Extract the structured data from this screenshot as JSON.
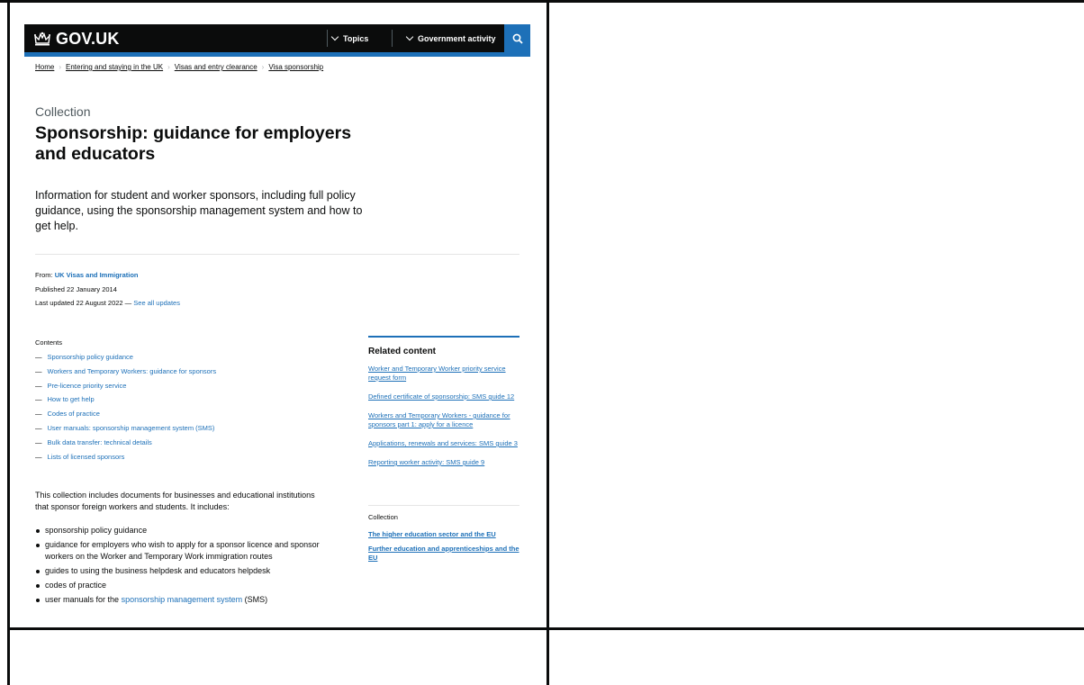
{
  "header": {
    "logo_text": "GOV.UK",
    "topics_label": "Topics",
    "gov_activity_label": "Government activity",
    "brand_colors": {
      "header_bg": "#0b0c0c",
      "accent": "#1d70b8"
    },
    "icons": [
      "crown-icon",
      "chevron-down-icon",
      "search-icon"
    ]
  },
  "breadcrumbs": [
    "Home",
    "Entering and staying in the UK",
    "Visas and entry clearance",
    "Visa sponsorship"
  ],
  "page": {
    "caption": "Collection",
    "title": "Sponsorship: guidance for employers and educators",
    "lead": "Information for student and worker sponsors, including full policy guidance, using the sponsorship management system and how to get help."
  },
  "metadata": {
    "from_label": "From:",
    "from_org": "UK Visas and Immigration",
    "published": "Published 22 January 2014",
    "last_updated": "Last updated 22 August 2022 —",
    "see_all_updates": "See all updates"
  },
  "contents": {
    "heading": "Contents",
    "items": [
      "Sponsorship policy guidance",
      "Workers and Temporary Workers: guidance for sponsors",
      "Pre-licence priority service",
      "How to get help",
      "Codes of practice",
      "User manuals: sponsorship management system (SMS)",
      "Bulk data transfer: technical details",
      "Lists of licensed sponsors"
    ]
  },
  "body": {
    "intro": "This collection includes documents for businesses and educational institutions that sponsor foreign workers and students. It includes:",
    "bullets": [
      "sponsorship policy guidance",
      "guidance for employers who wish to apply for a sponsor licence and sponsor workers on the Worker and Temporary Work immigration routes",
      "guides to using the business helpdesk and educators helpdesk",
      "codes of practice"
    ],
    "last_bullet_prefix": "user manuals for the",
    "last_bullet_link": "sponsorship management system",
    "last_bullet_suffix": "(SMS)"
  },
  "related": {
    "heading": "Related content",
    "items": [
      "Worker and Temporary Worker priority service request form",
      "Defined certificate of sponsorship: SMS guide 12",
      "Workers and Temporary Workers - guidance for sponsors part 1: apply for a licence",
      "Applications, renewals and services: SMS guide 3",
      "Reporting worker activity: SMS guide 9"
    ],
    "collection_heading": "Collection",
    "collection_items": [
      "The higher education sector and the EU",
      "Further education and apprenticeships and the EU"
    ]
  }
}
